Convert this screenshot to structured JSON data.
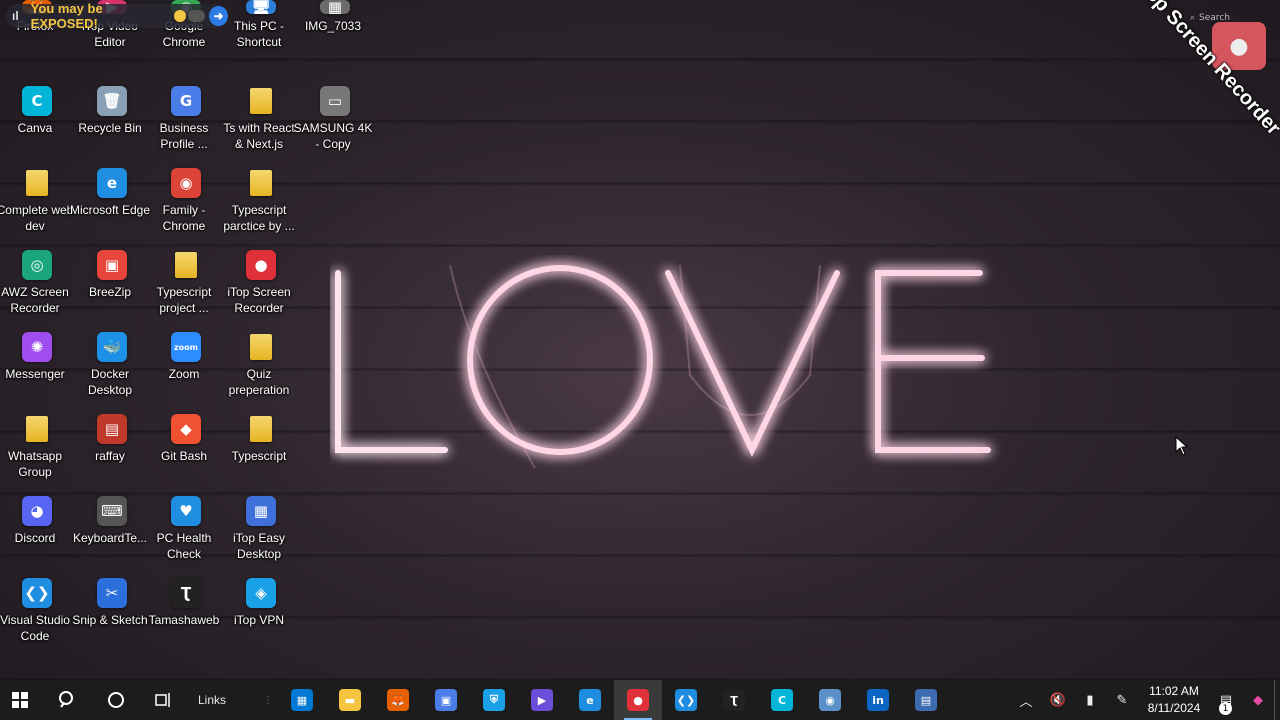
{
  "vpn_banner": {
    "text": "You may be EXPOSED!"
  },
  "watermark": {
    "text": "iTop Screen Recorder"
  },
  "top_search": {
    "placeholder": "Search"
  },
  "wallpaper": {
    "neon_text": "LOVE"
  },
  "desktop_icons": [
    {
      "label": "Firefox",
      "glyph": "🦊",
      "color": "#e66000"
    },
    {
      "label": "iTop Video Editor",
      "glyph": "▶",
      "color": "#d6336c"
    },
    {
      "label": "Google Chrome",
      "glyph": "◉",
      "color": "#34a853"
    },
    {
      "label": "This PC - Shortcut",
      "glyph": "🖥",
      "color": "#2b7fd8"
    },
    {
      "label": "IMG_7033",
      "glyph": "▦",
      "color": "#6c6c6c"
    },
    {
      "label": "Canva",
      "glyph": "C",
      "color": "#00b5d8"
    },
    {
      "label": "Recycle Bin",
      "glyph": "🗑",
      "color": "#8aa0b5"
    },
    {
      "label": "Business Profile ...",
      "glyph": "G",
      "color": "#4a7de8"
    },
    {
      "label": "Ts with React & Next.js",
      "glyph": "",
      "color": "#f5d76e"
    },
    {
      "label": "SAMSUNG 4K - Copy",
      "glyph": "▭",
      "color": "#777"
    },
    {
      "label": "Complete web dev",
      "glyph": "",
      "color": "#f5d76e"
    },
    {
      "label": "Microsoft Edge",
      "glyph": "e",
      "color": "#1f8de0"
    },
    {
      "label": "Family - Chrome",
      "glyph": "◉",
      "color": "#db4437"
    },
    {
      "label": "Typescript parctice by ...",
      "glyph": "",
      "color": "#f5d76e"
    },
    {
      "label": "AWZ Screen Recorder",
      "glyph": "◎",
      "color": "#1aa57a"
    },
    {
      "label": "BreeZip",
      "glyph": "▣",
      "color": "#e8453c"
    },
    {
      "label": "Typescript project ...",
      "glyph": "",
      "color": "#f5d76e"
    },
    {
      "label": "iTop Screen Recorder",
      "glyph": "●",
      "color": "#e0303a"
    },
    {
      "label": "Messenger",
      "glyph": "✺",
      "color": "#a04df0"
    },
    {
      "label": "Docker Desktop",
      "glyph": "🐳",
      "color": "#1d91e6"
    },
    {
      "label": "Zoom",
      "glyph": "zoom",
      "color": "#2d8cff"
    },
    {
      "label": "Quiz preperation",
      "glyph": "",
      "color": "#f5d76e"
    },
    {
      "label": "Whatsapp Group",
      "glyph": "",
      "color": "#f5d76e"
    },
    {
      "label": "raffay",
      "glyph": "▤",
      "color": "#c0392b"
    },
    {
      "label": "Git Bash",
      "glyph": "◆",
      "color": "#f05133"
    },
    {
      "label": "Typescript",
      "glyph": "",
      "color": "#f5d76e"
    },
    {
      "label": "Discord",
      "glyph": "◕",
      "color": "#5865f2"
    },
    {
      "label": "KeyboardTe...",
      "glyph": "⌨",
      "color": "#555"
    },
    {
      "label": "PC Health Check",
      "glyph": "♥",
      "color": "#1f8de0"
    },
    {
      "label": "iTop Easy Desktop",
      "glyph": "▦",
      "color": "#3f6fd8"
    },
    {
      "label": "Visual Studio Code",
      "glyph": "❮❯",
      "color": "#1f8de0"
    },
    {
      "label": "Snip & Sketch",
      "glyph": "✂",
      "color": "#2a6fdb"
    },
    {
      "label": "Tamashaweb",
      "glyph": "Ʈ",
      "color": "#222"
    },
    {
      "label": "iTop VPN",
      "glyph": "◈",
      "color": "#1aa0e6"
    }
  ],
  "taskbar": {
    "links_label": "Links",
    "apps": [
      {
        "name": "microsoft-store",
        "glyph": "▦",
        "color": "#0078d4",
        "active": false
      },
      {
        "name": "file-explorer",
        "glyph": "▬",
        "color": "#f5c542",
        "active": false
      },
      {
        "name": "firefox",
        "glyph": "🦊",
        "color": "#e66000",
        "active": false
      },
      {
        "name": "business-profile",
        "glyph": "▣",
        "color": "#4a7de8",
        "active": false
      },
      {
        "name": "shield",
        "glyph": "⛨",
        "color": "#1aa0e6",
        "active": false
      },
      {
        "name": "media-player",
        "glyph": "▶",
        "color": "#6b4fd8",
        "active": false
      },
      {
        "name": "edge",
        "glyph": "e",
        "color": "#1f8de0",
        "active": false
      },
      {
        "name": "itop-screen-recorder",
        "glyph": "●",
        "color": "#e0303a",
        "active": true
      },
      {
        "name": "vscode",
        "glyph": "❮❯",
        "color": "#1f8de0",
        "active": false
      },
      {
        "name": "tamashaweb",
        "glyph": "Ʈ",
        "color": "#222",
        "active": false
      },
      {
        "name": "canva",
        "glyph": "C",
        "color": "#00b5d8",
        "active": false
      },
      {
        "name": "browser",
        "glyph": "◉",
        "color": "#5a8fc8",
        "active": false
      },
      {
        "name": "linkedin",
        "glyph": "in",
        "color": "#0a66c2",
        "active": false
      },
      {
        "name": "remote-app",
        "glyph": "▤",
        "color": "#3d6bb0",
        "active": false
      }
    ],
    "clock_time": "11:02 AM",
    "clock_date": "8/11/2024",
    "notification_count": "1"
  }
}
